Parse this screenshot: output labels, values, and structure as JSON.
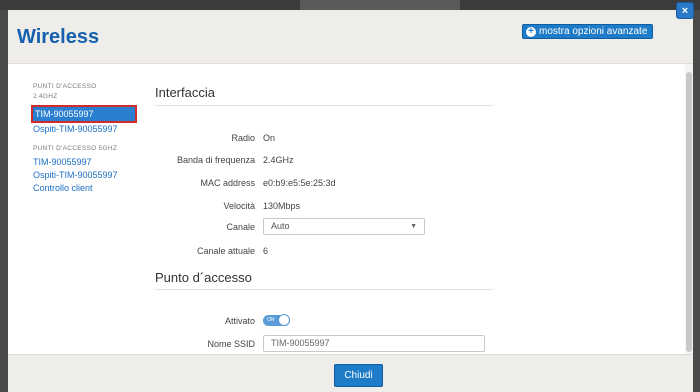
{
  "header": {
    "title": "Wireless",
    "advanced_label": "mostra opzioni avanzate",
    "close_glyph": "×"
  },
  "sidebar": {
    "section1_line1": "PUNTI D'ACCESSO",
    "section1_line2": "2.4GHZ",
    "section2": "PUNTI D'ACCESSO 5GHZ",
    "items": [
      {
        "label": "TIM-90055997"
      },
      {
        "label": "Ospiti-TIM-90055997"
      },
      {
        "label": "TIM-90055997"
      },
      {
        "label": "Ospiti-TIM-90055997"
      },
      {
        "label": "Controllo client"
      }
    ]
  },
  "interfaccia": {
    "title": "Interfaccia",
    "radio_label": "Radio",
    "radio_value": "On",
    "banda_label": "Banda di frequenza",
    "banda_value": "2.4GHz",
    "mac_label": "MAC address",
    "mac_value": "e0:b9:e5:5e:25:3d",
    "velocita_label": "Velocità",
    "velocita_value": "130Mbps",
    "canale_label": "Canale",
    "canale_value": "Auto",
    "canale_attuale_label": "Canale attuale",
    "canale_attuale_value": "6"
  },
  "punto_accesso": {
    "title": "Punto d´accesso",
    "attivato_label": "Attivato",
    "toggle_text": "ON",
    "ssid_label": "Nome SSID",
    "ssid_value": "TIM-90055997"
  },
  "footer": {
    "close_label": "Chiudi"
  },
  "colors": {
    "accent": "#1e7bc8",
    "title": "#1560ae",
    "selection_border": "#d12b2b"
  }
}
